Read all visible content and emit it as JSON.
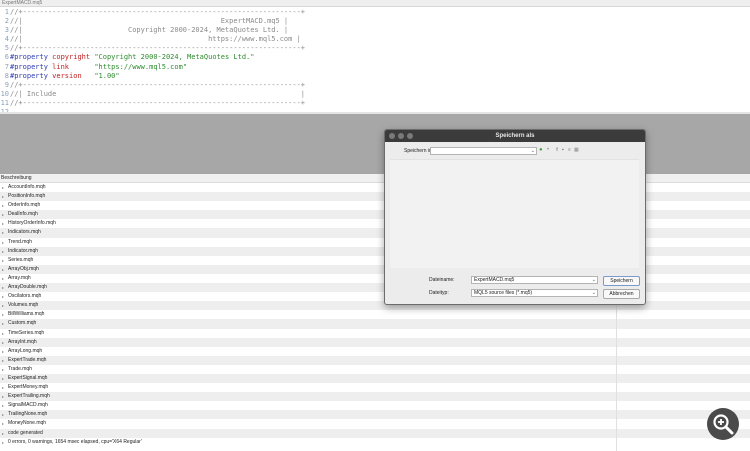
{
  "window": {
    "title": "ExpertMACD.mq5"
  },
  "editor": {
    "lines": [
      {
        "n": "1",
        "segs": [
          {
            "cls": "c-comment",
            "t": "//+------------------------------------------------------------------+"
          }
        ]
      },
      {
        "n": "2",
        "segs": [
          {
            "cls": "c-comment",
            "t": "//|                                               ExpertMACD.mq5 |"
          }
        ]
      },
      {
        "n": "3",
        "segs": [
          {
            "cls": "c-comment",
            "t": "//|                         Copyright 2000-2024, MetaQuotes Ltd. |"
          }
        ]
      },
      {
        "n": "4",
        "segs": [
          {
            "cls": "c-comment",
            "t": "//|                                            https://www.mql5.com |"
          }
        ]
      },
      {
        "n": "5",
        "segs": [
          {
            "cls": "c-comment",
            "t": "//+------------------------------------------------------------------+"
          }
        ]
      },
      {
        "n": "6",
        "segs": [
          {
            "cls": "c-dir",
            "t": "#property "
          },
          {
            "cls": "c-kw",
            "t": "copyright "
          },
          {
            "cls": "c-str",
            "t": "\"Copyright 2000-2024, MetaQuotes Ltd.\""
          }
        ]
      },
      {
        "n": "7",
        "segs": [
          {
            "cls": "c-dir",
            "t": "#property "
          },
          {
            "cls": "c-kw",
            "t": "link      "
          },
          {
            "cls": "c-str",
            "t": "\"https://www.mql5.com\""
          }
        ]
      },
      {
        "n": "8",
        "segs": [
          {
            "cls": "c-dir",
            "t": "#property "
          },
          {
            "cls": "c-kw",
            "t": "version   "
          },
          {
            "cls": "c-str",
            "t": "\"1.00\""
          }
        ]
      },
      {
        "n": "9",
        "segs": [
          {
            "cls": "c-comment",
            "t": "//+------------------------------------------------------------------+"
          }
        ]
      },
      {
        "n": "10",
        "segs": [
          {
            "cls": "c-comment",
            "t": "//| Include                                                          |"
          }
        ]
      },
      {
        "n": "11",
        "segs": [
          {
            "cls": "c-comment",
            "t": "//+------------------------------------------------------------------+"
          }
        ]
      },
      {
        "n": "12",
        "segs": [
          {
            "cls": "c-comment",
            "t": ""
          }
        ]
      }
    ]
  },
  "output": {
    "header": "Beschreibung",
    "rows": [
      "AccountInfo.mqh",
      "PositionInfo.mqh",
      "OrderInfo.mqh",
      "DealInfo.mqh",
      "HistoryOrderInfo.mqh",
      "Indicators.mqh",
      "Trend.mqh",
      "Indicator.mqh",
      "Series.mqh",
      "ArrayObj.mqh",
      "Array.mqh",
      "ArrayDouble.mqh",
      "Oscilators.mqh",
      "Volumes.mqh",
      "BillWilliams.mqh",
      "Custom.mqh",
      "TimeSeries.mqh",
      "ArrayInt.mqh",
      "ArrayLong.mqh",
      "ExpertTrade.mqh",
      "Trade.mqh",
      "ExpertSignal.mqh",
      "ExpertMoney.mqh",
      "ExpertTrailing.mqh",
      "SignalMACD.mqh",
      "TrailingNone.mqh",
      "MoneyNone.mqh",
      "code generated",
      "0 errors, 0 warnings, 1654 msec elapsed, cpu='X64 Regular'"
    ]
  },
  "dialog": {
    "title": "Speichern als",
    "save_in_label": "Speichern in:",
    "save_in_value": "",
    "filename_label": "Dateiname:",
    "filename_value": "ExpertMACD.mq5",
    "filetype_label": "Dateityp:",
    "filetype_value": "MQL5 source files (*.mq5)",
    "save_button": "Speichern",
    "cancel_button": "Abbrechen"
  },
  "icons": {
    "zoom": "zoom-in-icon",
    "back": "back-arrow-icon",
    "forward": "forward-arrow-icon",
    "up": "up-folder-icon",
    "new_folder": "new-folder-icon",
    "list_view": "list-view-icon",
    "detail_view": "detail-view-icon"
  }
}
